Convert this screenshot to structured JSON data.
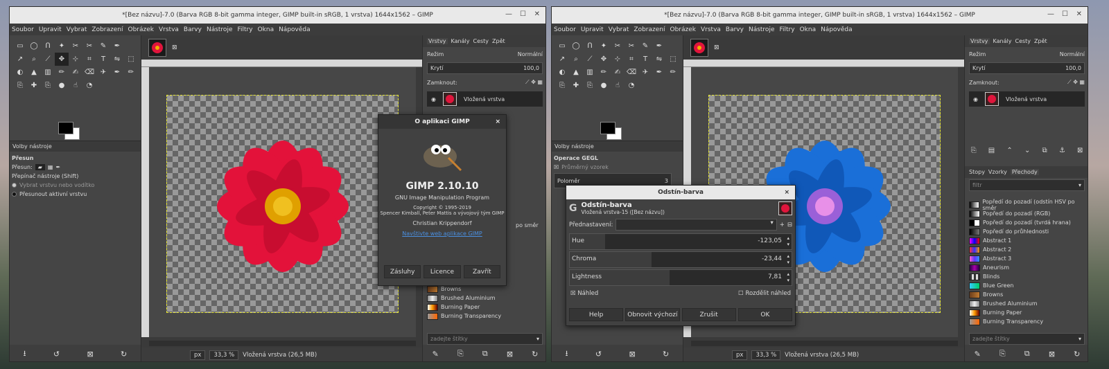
{
  "left_window": {
    "title": "*[Bez názvu]-7.0 (Barva RGB 8-bit gamma integer, GIMP built-in sRGB, 1 vrstva) 1644x1562 – GIMP",
    "menu": [
      "Soubor",
      "Upravit",
      "Vybrat",
      "Zobrazení",
      "Obrázek",
      "Vrstva",
      "Barvy",
      "Nástroje",
      "Filtry",
      "Okna",
      "Nápověda"
    ],
    "tool_options_tab": "Volby nástroje",
    "tool_name": "Přesun",
    "move_label": "Přesun:",
    "switch_label": "Přepínač nástroje  (Shift)",
    "opt1": "Vybrat vrstvu nebo vodítko",
    "opt2": "Přesunout aktivní vrstvu",
    "status": {
      "unit": "px",
      "zoom": "33,3 %",
      "layer": "Vložená vrstva (26,5 MB)"
    },
    "layers_tabs": [
      "Vrstvy",
      "Kanály",
      "Cesty",
      "Zpět"
    ],
    "mode_label": "Režim",
    "mode_value": "Normální",
    "opacity_label": "Krytí",
    "opacity_value": "100,0",
    "lock_label": "Zamknout:",
    "layer_name": "Vložená vrstva",
    "gradients_partial": [
      "po směr"
    ],
    "gradients": [
      "Browns",
      "Brushed Aluminium",
      "Burning Paper",
      "Burning Transparency"
    ],
    "filter_placeholder": "zadejte štítky",
    "about": {
      "title": "O aplikaci GIMP",
      "version": "GIMP 2.10.10",
      "subtitle": "GNU Image Manipulation Program",
      "copyright": "Copyright © 1995-2019",
      "authors": "Spencer Kimball, Peter Mattis a vývojový tým GIMP",
      "credit": "Christian Krippendorf",
      "link": "Navštivte web aplikace GIMP",
      "buttons": [
        "Zásluhy",
        "Licence",
        "Zavřít"
      ]
    }
  },
  "right_window": {
    "title": "*[Bez názvu]-7.0 (Barva RGB 8-bit gamma integer, GIMP built-in sRGB, 1 vrstva) 1644x1562 – GIMP",
    "menu": [
      "Soubor",
      "Upravit",
      "Vybrat",
      "Zobrazení",
      "Obrázek",
      "Vrstva",
      "Barvy",
      "Nástroje",
      "Filtry",
      "Okna",
      "Nápověda"
    ],
    "tool_options_tab": "Volby nástroje",
    "gegl_title": "Operace GEGL",
    "gegl_avg": "Průměrný vzorek",
    "radius_label": "Poloměr",
    "radius_value": "3",
    "status": {
      "unit": "px",
      "zoom": "33,3 %",
      "layer": "Vložená vrstva (26,5 MB)"
    },
    "layers_tabs": [
      "Vrstvy",
      "Kanály",
      "Cesty",
      "Zpět"
    ],
    "mode_label": "Režim",
    "mode_value": "Normální",
    "opacity_label": "Krytí",
    "opacity_value": "100,0",
    "lock_label": "Zamknout:",
    "layer_name": "Vložená vrstva",
    "bottom_tabs": [
      "Stopy",
      "Vzorky",
      "Přechody"
    ],
    "filter_top": "filtr",
    "gradients": [
      "Popředí do pozadí (odstín HSV po směr",
      "Popředí do pozadí (RGB)",
      "Popředí do pozadí (tvrdá hrana)",
      "Popředí do průhlednosti",
      "Abstract 1",
      "Abstract 2",
      "Abstract 3",
      "Aneurism",
      "Blinds",
      "Blue Green",
      "Browns",
      "Brushed Aluminium",
      "Burning Paper",
      "Burning Transparency"
    ],
    "filter_placeholder": "zadejte štítky",
    "hue_dialog": {
      "title": "Odstín-barva",
      "heading": "Odstín-barva",
      "subheading": "Vložená vrstva-15 ([Bez názvu])",
      "presets_label": "Přednastavení:",
      "hue_label": "Hue",
      "hue_value": "-123,05",
      "chroma_label": "Chroma",
      "chroma_value": "-23,44",
      "lightness_label": "Lightness",
      "lightness_value": "7,81",
      "preview_label": "Náhled",
      "split_label": "Rozdělit náhled",
      "buttons": [
        "Help",
        "Obnovit výchozí",
        "Zrušit",
        "OK"
      ]
    }
  }
}
